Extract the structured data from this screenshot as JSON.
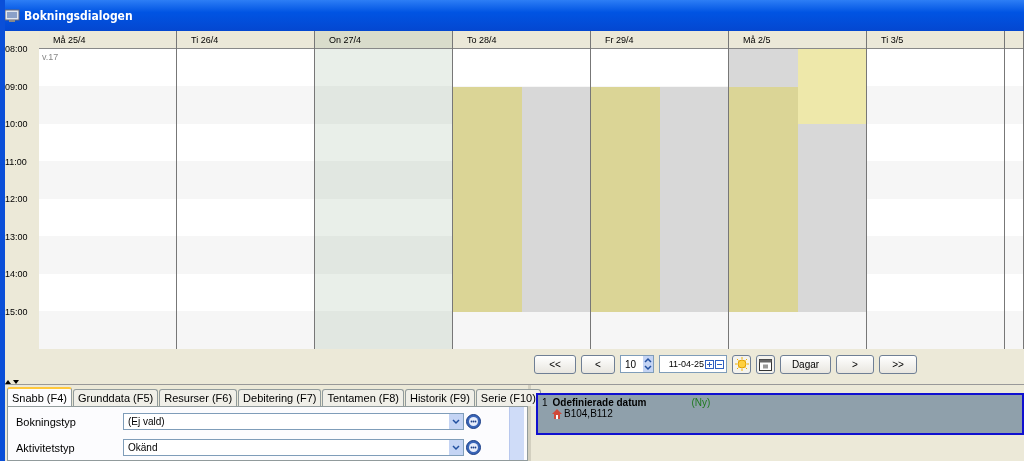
{
  "window": {
    "title": "Bokningsdialogen"
  },
  "calendar": {
    "week_label": "v.17",
    "hours": [
      "08:00",
      "09:00",
      "10:00",
      "11:00",
      "12:00",
      "13:00",
      "14:00",
      "15:00"
    ],
    "days": [
      {
        "label": "Må 25/4",
        "selected": false
      },
      {
        "label": "Ti 26/4",
        "selected": false
      },
      {
        "label": "On 27/4",
        "selected": true
      },
      {
        "label": "To 28/4",
        "selected": false,
        "lanes": [
          [
            {
              "kind": "free"
            },
            {
              "kind": "booked",
              "color": "#dbd596"
            },
            {
              "kind": "booked",
              "color": "#dbd596"
            },
            {
              "kind": "booked",
              "color": "#dbd596"
            },
            {
              "kind": "booked",
              "color": "#dbd596"
            },
            {
              "kind": "booked",
              "color": "#dbd596"
            },
            {
              "kind": "booked",
              "color": "#dbd596"
            },
            {
              "kind": "free"
            }
          ],
          [
            {
              "kind": "free"
            },
            {
              "kind": "booked",
              "color": "#d8d8d8"
            },
            {
              "kind": "booked",
              "color": "#d8d8d8"
            },
            {
              "kind": "booked",
              "color": "#d8d8d8"
            },
            {
              "kind": "booked",
              "color": "#d8d8d8"
            },
            {
              "kind": "booked",
              "color": "#d8d8d8"
            },
            {
              "kind": "booked",
              "color": "#d8d8d8"
            },
            {
              "kind": "free"
            }
          ]
        ]
      },
      {
        "label": "Fr 29/4",
        "selected": false,
        "lanes": [
          [
            {
              "kind": "free"
            },
            {
              "kind": "booked",
              "color": "#dbd596"
            },
            {
              "kind": "booked",
              "color": "#dbd596"
            },
            {
              "kind": "booked",
              "color": "#dbd596"
            },
            {
              "kind": "booked",
              "color": "#dbd596"
            },
            {
              "kind": "booked",
              "color": "#dbd596"
            },
            {
              "kind": "booked",
              "color": "#dbd596"
            },
            {
              "kind": "free"
            }
          ],
          [
            {
              "kind": "free"
            },
            {
              "kind": "booked",
              "color": "#d8d8d8"
            },
            {
              "kind": "booked",
              "color": "#d8d8d8"
            },
            {
              "kind": "booked",
              "color": "#d8d8d8"
            },
            {
              "kind": "booked",
              "color": "#d8d8d8"
            },
            {
              "kind": "booked",
              "color": "#d8d8d8"
            },
            {
              "kind": "booked",
              "color": "#d8d8d8"
            },
            {
              "kind": "free"
            }
          ]
        ]
      },
      {
        "label": "Må 2/5",
        "selected": false,
        "lanes": [
          [
            {
              "kind": "booked",
              "color": "#d8d8d8"
            },
            {
              "kind": "booked",
              "color": "#dbd596"
            },
            {
              "kind": "booked",
              "color": "#dbd596"
            },
            {
              "kind": "booked",
              "color": "#dbd596"
            },
            {
              "kind": "booked",
              "color": "#dbd596"
            },
            {
              "kind": "booked",
              "color": "#dbd596"
            },
            {
              "kind": "booked",
              "color": "#dbd596"
            },
            {
              "kind": "free"
            }
          ],
          [
            {
              "kind": "booked",
              "color": "#eee8aa"
            },
            {
              "kind": "booked",
              "color": "#eee8aa"
            },
            {
              "kind": "booked",
              "color": "#d8d8d8"
            },
            {
              "kind": "booked",
              "color": "#d8d8d8"
            },
            {
              "kind": "booked",
              "color": "#d8d8d8"
            },
            {
              "kind": "booked",
              "color": "#d8d8d8"
            },
            {
              "kind": "booked",
              "color": "#d8d8d8"
            },
            {
              "kind": "free"
            }
          ]
        ]
      },
      {
        "label": "Ti 3/5",
        "selected": false
      }
    ]
  },
  "navigation": {
    "first": "<<",
    "previous": "<",
    "count": "10",
    "date": "11-04-25",
    "mode": "Dagar",
    "next": ">",
    "last": ">>"
  },
  "tabs": [
    {
      "label": "Snabb (F4)",
      "selected": true
    },
    {
      "label": "Grunddata (F5)",
      "selected": false
    },
    {
      "label": "Resurser (F6)",
      "selected": false
    },
    {
      "label": "Debitering (F7)",
      "selected": false
    },
    {
      "label": "Tentamen (F8)",
      "selected": false
    },
    {
      "label": "Historik (F9)",
      "selected": false
    },
    {
      "label": "Serie (F10)",
      "selected": false
    }
  ],
  "fields": [
    {
      "label": "Bokningstyp",
      "value": "(Ej vald)"
    },
    {
      "label": "Aktivitetstyp",
      "value": "Okänd"
    }
  ],
  "bookings": [
    {
      "number": "1",
      "title": "Odefinierade datum",
      "status": "(Ny)",
      "rooms": "B104,B112",
      "selected": true
    }
  ]
}
